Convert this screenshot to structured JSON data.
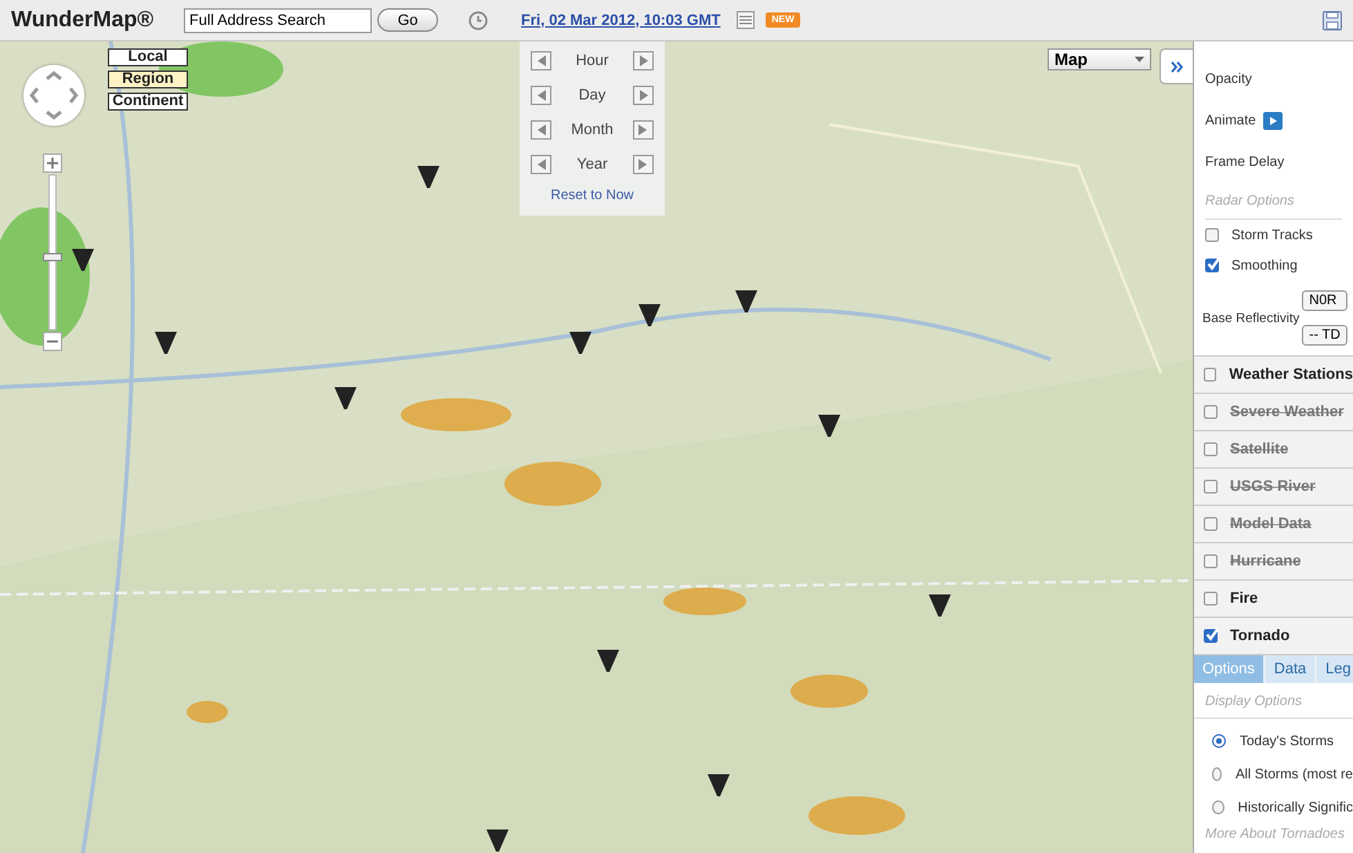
{
  "header": {
    "logo": "WunderMap®",
    "search": {
      "value": "Full Address Search"
    },
    "go_button": "Go",
    "date_link": "Fri, 02 Mar 2012, 10:03 GMT",
    "new_badge": "NEW"
  },
  "map": {
    "kind": "picture",
    "scale_buttons": [
      {
        "label": "Local",
        "selected": false
      },
      {
        "label": "Region",
        "selected": true
      },
      {
        "label": "Continent",
        "selected": false
      }
    ],
    "zoom": {
      "level": 0.47
    },
    "time_steps": [
      "Hour",
      "Day",
      "Month",
      "Year"
    ],
    "reset_link": "Reset to Now",
    "map_type": "Map"
  },
  "sidebar": {
    "settings": [
      {
        "kind": "label",
        "label": "Opacity"
      },
      {
        "kind": "play",
        "label": "Animate"
      },
      {
        "kind": "label",
        "label": "Frame Delay"
      },
      {
        "kind": "heading",
        "label": "Radar Options"
      },
      {
        "kind": "checkbox",
        "label": "Storm Tracks",
        "checked": false
      },
      {
        "kind": "checkbox",
        "label": "Smoothing",
        "checked": true
      },
      {
        "kind": "buttons",
        "label": "Base Reflectivity",
        "buttons": [
          "N0R",
          "-- TD"
        ]
      }
    ],
    "layers": [
      {
        "label": "Weather Stations",
        "checked": false,
        "disabled": false
      },
      {
        "label": "Severe Weather",
        "checked": false,
        "disabled": true
      },
      {
        "label": "Satellite",
        "checked": false,
        "disabled": true
      },
      {
        "label": "USGS River",
        "checked": false,
        "disabled": true
      },
      {
        "label": "Model Data",
        "checked": false,
        "disabled": true
      },
      {
        "label": "Hurricane",
        "checked": false,
        "disabled": true
      },
      {
        "label": "Fire",
        "checked": false,
        "disabled": false
      },
      {
        "label": "Tornado",
        "checked": true,
        "disabled": false
      }
    ],
    "tabs": [
      {
        "label": "Options",
        "selected": true
      },
      {
        "label": "Data",
        "selected": false
      },
      {
        "label": "Leg",
        "selected": false
      }
    ],
    "display_heading": "Display Options",
    "storm_options": [
      {
        "label": "Today's Storms",
        "selected": true
      },
      {
        "label": "All Storms (most re",
        "selected": false
      },
      {
        "label": "Historically Signific",
        "selected": false
      }
    ],
    "more_link": "More About Tornadoes"
  }
}
